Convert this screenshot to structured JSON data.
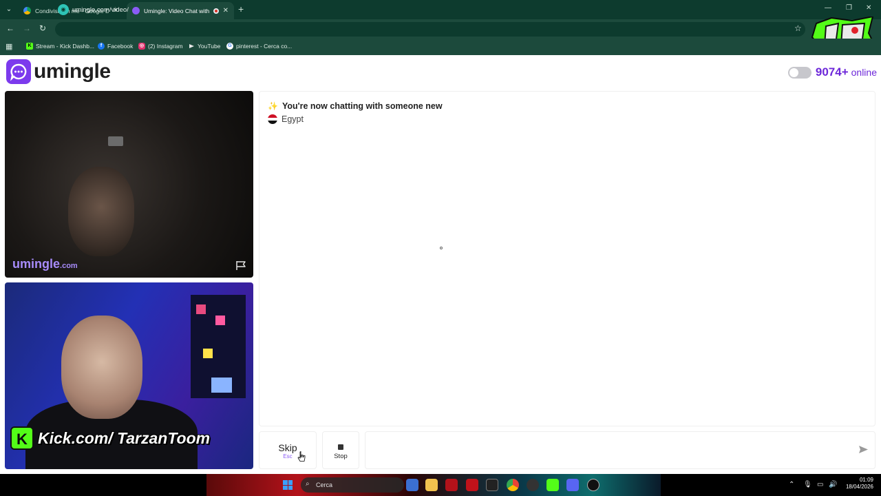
{
  "browser": {
    "tabs": [
      {
        "title": "Condivisi con me - Google Dri",
        "active": false,
        "favicon_icon": "google-drive-icon"
      },
      {
        "title": "Umingle: Video Chat with S",
        "active": true,
        "favicon_icon": "umingle-icon",
        "recording": true
      }
    ],
    "url": "umingle.com/video/",
    "bookmarks": [
      {
        "label": "Stream - Kick Dashb...",
        "icon": "kick-icon",
        "color": "#53fc18"
      },
      {
        "label": "Facebook",
        "icon": "facebook-icon",
        "color": "#1877f2"
      },
      {
        "label": "(2) Instagram",
        "icon": "instagram-icon",
        "color": "#e1306c"
      },
      {
        "label": "YouTube",
        "icon": "youtube-icon",
        "color": "#ff0000"
      },
      {
        "label": "pinterest - Cerca co...",
        "icon": "google-icon",
        "color": "#ffffff"
      }
    ],
    "theme_color": "#1c4a3c"
  },
  "header": {
    "brand": "umingle",
    "online_count": "9074+",
    "online_label": "online",
    "accent": "#6d28d9"
  },
  "remote_video": {
    "watermark_main": "umingle",
    "watermark_suffix": ".com"
  },
  "local_video": {
    "overlay_badge": "K",
    "overlay_text": "Kick.com/ TarzanToom"
  },
  "chat": {
    "status_message": "You're now chatting with someone new",
    "country": "Egypt"
  },
  "controls": {
    "skip_label": "Skip",
    "skip_shortcut": "Esc",
    "stop_label": "Stop",
    "message_value": ""
  },
  "taskbar": {
    "search_placeholder": "Cerca",
    "time": "01:09",
    "date": "18/04/2026"
  }
}
